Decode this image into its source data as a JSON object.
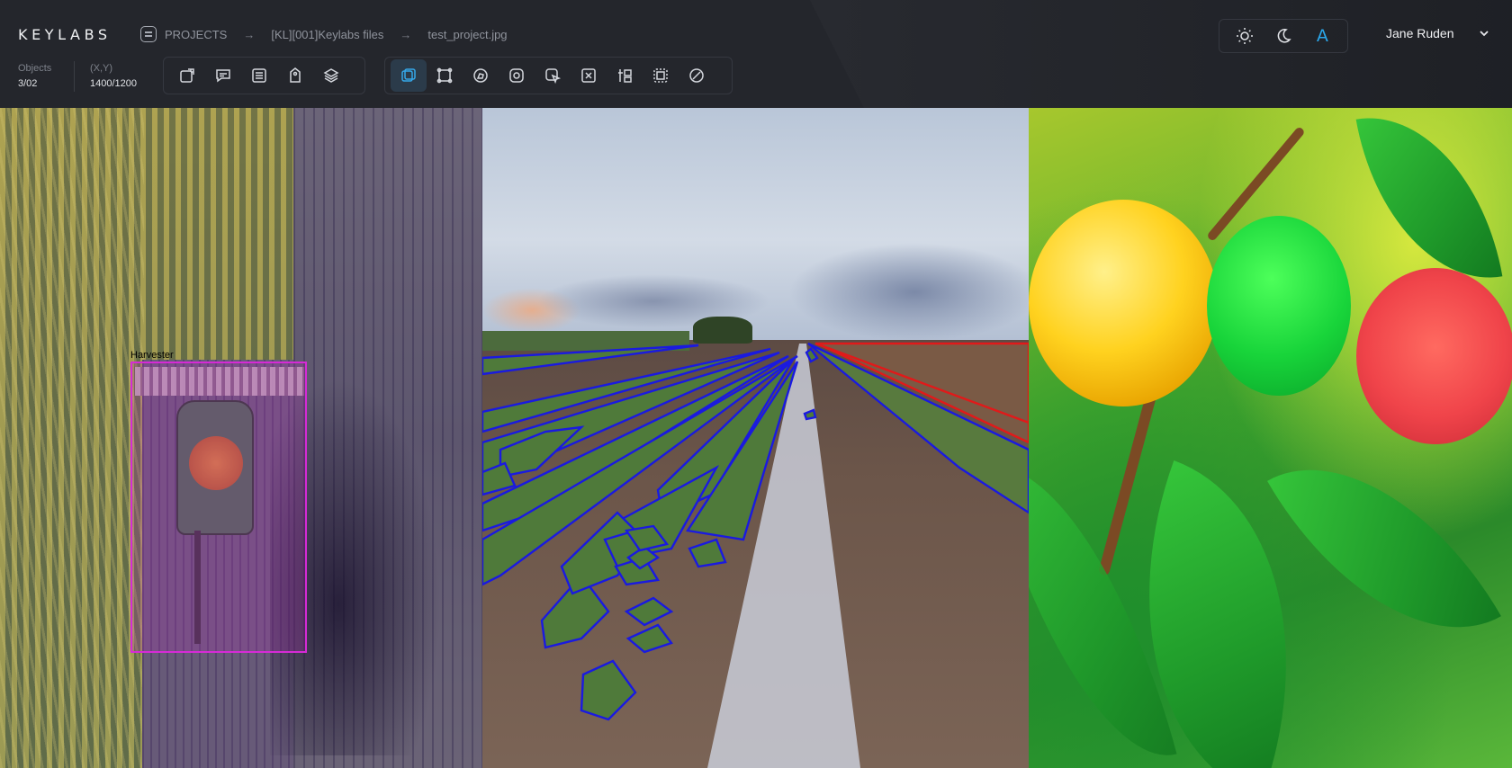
{
  "app": {
    "logo": "KEYLABS"
  },
  "breadcrumb": {
    "items": [
      "PROJECTS",
      "[KL][001]Keylabs files",
      "test_project.jpg"
    ],
    "separator": "→"
  },
  "stats": {
    "objects_label": "Objects",
    "objects_value": "3/02",
    "coords_label": "(X,Y)",
    "coords_value": "1400/1200"
  },
  "toolbar_left": {
    "tools": [
      "new-object-icon",
      "comment-icon",
      "list-icon",
      "tag-icon",
      "layers-icon"
    ]
  },
  "toolbar_annotation": {
    "active": "bounding-box-icon",
    "tools": [
      "bounding-box-icon",
      "points-box-icon",
      "polygon-icon",
      "segment-icon",
      "cursor-select-icon",
      "text-box-icon",
      "tracking-icon",
      "grid-select-icon",
      "no-entry-icon"
    ]
  },
  "theme": {
    "options": [
      "light-theme-icon",
      "dark-theme-icon",
      "auto-theme-icon"
    ],
    "auto_label": "A",
    "active": "auto",
    "accent": "#2ba7ea"
  },
  "user": {
    "name": "Jane Ruden"
  },
  "annotations": {
    "harvester_label": "Harvester",
    "bbox_color": "#d62ad6",
    "polygon_color_rows": "#1a1ae0",
    "polygon_color_field": "#e01a1a"
  }
}
